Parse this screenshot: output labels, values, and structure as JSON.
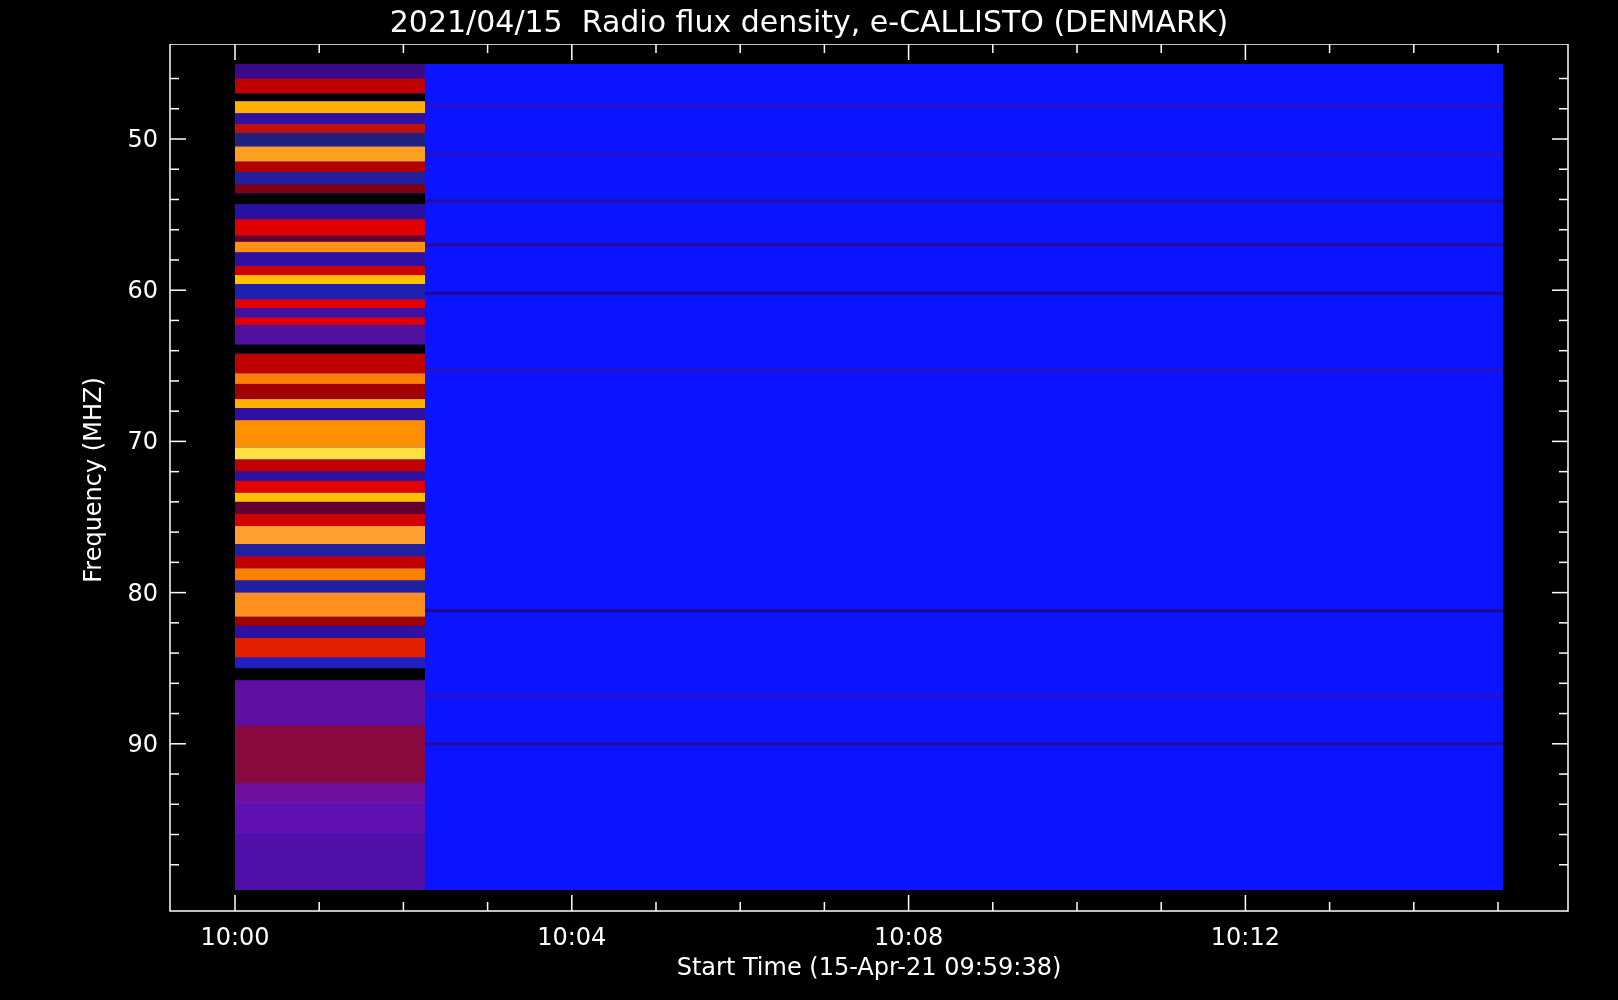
{
  "title": "2021/04/15  Radio flux density, e-CALLISTO (DENMARK)",
  "x_axis": {
    "label": "Start Time (15-Apr-21 09:59:38)",
    "ticks": [
      "10:00",
      "10:04",
      "10:08",
      "10:12"
    ]
  },
  "y_axis": {
    "label": "Frequency (MHZ)",
    "ticks": [
      "50",
      "60",
      "70",
      "80",
      "90"
    ]
  }
}
